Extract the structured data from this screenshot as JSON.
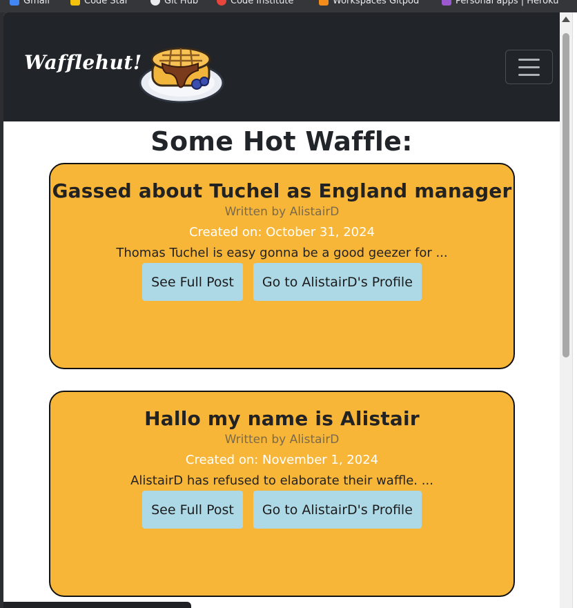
{
  "bookmarks": [
    {
      "label": "Gmail",
      "color": "#4285f4"
    },
    {
      "label": "Code Star",
      "color": "#f4c20d"
    },
    {
      "label": "Git Hub",
      "color": "#e8eaed"
    },
    {
      "label": "Code Institute",
      "color": "#e8453c"
    },
    {
      "label": "Workspaces Gitpod",
      "color": "#f48c1c"
    },
    {
      "label": "Personal apps | Heroku",
      "color": "#9b59d0"
    }
  ],
  "navbar": {
    "brand": "Wafflehut!",
    "logo_icon": "waffle-stack-icon",
    "toggler_icon": "hamburger-menu-icon"
  },
  "main": {
    "title": "Some Hot Waffle:"
  },
  "posts": [
    {
      "title": "Gassed about Tuchel as England manager",
      "author": "Written by AlistairD",
      "created": "Created on: October 31, 2024",
      "excerpt": "Thomas Tuchel is easy gonna be a good geezer for ...",
      "view_label": "See Full Post",
      "profile_label": "Go to AlistairD's Profile"
    },
    {
      "title": "Hallo my name is Alistair",
      "author": "Written by AlistairD",
      "created": "Created on: November 1, 2024",
      "excerpt": "AlistairD has refused to elaborate their waffle. ...",
      "view_label": "See Full Post",
      "profile_label": "Go to AlistairD's Profile"
    }
  ],
  "colors": {
    "navbar": "#212529",
    "card": "#f8b638",
    "button": "#add8e6"
  }
}
